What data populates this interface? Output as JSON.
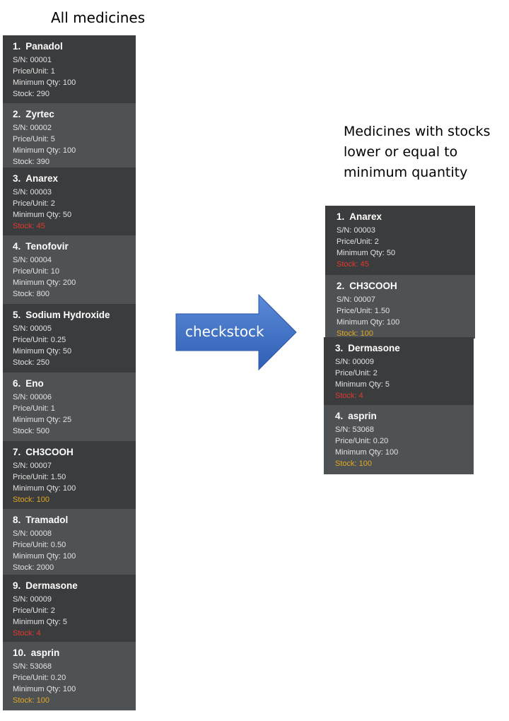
{
  "left_title": "All medicines",
  "right_title": "Medicines with stocks lower or equal to minimum quantity",
  "command": "checkstock",
  "colors": {
    "card_dark": "#3b3c3e",
    "card_light": "#4f5254",
    "stock_below_minimum": "#e03a2e",
    "stock_at_minimum": "#e2a822",
    "arrow": "#4a78c8"
  },
  "all_medicines": [
    {
      "index": "1.",
      "name": "Panadol",
      "sn": "S/N: 00001",
      "price": "Price/Unit: 1",
      "min": "Minimum Qty: 100",
      "stock": "Stock: 290",
      "stock_status": "normal"
    },
    {
      "index": "2.",
      "name": "Zyrtec",
      "sn": "S/N: 00002",
      "price": "Price/Unit: 5",
      "min": "Minimum Qty: 100",
      "stock": "Stock: 390",
      "stock_status": "normal"
    },
    {
      "index": "3.",
      "name": "Anarex",
      "sn": "S/N: 00003",
      "price": "Price/Unit: 2",
      "min": "Minimum Qty: 50",
      "stock": "Stock: 45",
      "stock_status": "low"
    },
    {
      "index": "4.",
      "name": "Tenofovir",
      "sn": "S/N: 00004",
      "price": "Price/Unit: 10",
      "min": "Minimum Qty: 200",
      "stock": "Stock: 800",
      "stock_status": "normal"
    },
    {
      "index": "5.",
      "name": "Sodium Hydroxide",
      "sn": "S/N: 00005",
      "price": "Price/Unit: 0.25",
      "min": "Minimum Qty: 50",
      "stock": "Stock: 250",
      "stock_status": "normal"
    },
    {
      "index": "6.",
      "name": "Eno",
      "sn": "S/N: 00006",
      "price": "Price/Unit: 1",
      "min": "Minimum Qty: 25",
      "stock": "Stock: 500",
      "stock_status": "normal"
    },
    {
      "index": "7.",
      "name": "CH3COOH",
      "sn": "S/N: 00007",
      "price": "Price/Unit: 1.50",
      "min": "Minimum Qty: 100",
      "stock": "Stock: 100",
      "stock_status": "equal"
    },
    {
      "index": "8.",
      "name": "Tramadol",
      "sn": "S/N: 00008",
      "price": "Price/Unit: 0.50",
      "min": "Minimum Qty: 100",
      "stock": "Stock: 2000",
      "stock_status": "normal"
    },
    {
      "index": "9.",
      "name": "Dermasone",
      "sn": "S/N: 00009",
      "price": "Price/Unit: 2",
      "min": "Minimum Qty: 5",
      "stock": "Stock: 4",
      "stock_status": "low"
    },
    {
      "index": "10.",
      "name": "asprin",
      "sn": "S/N: 53068",
      "price": "Price/Unit: 0.20",
      "min": "Minimum Qty: 100",
      "stock": "Stock: 100",
      "stock_status": "equal"
    }
  ],
  "low_stock_medicines": [
    {
      "index": "1.",
      "name": "Anarex",
      "sn": "S/N: 00003",
      "price": "Price/Unit: 2",
      "min": "Minimum Qty: 50",
      "stock": "Stock: 45",
      "stock_status": "low"
    },
    {
      "index": "2.",
      "name": "CH3COOH",
      "sn": "S/N: 00007",
      "price": "Price/Unit: 1.50",
      "min": "Minimum Qty: 100",
      "stock": "Stock: 100",
      "stock_status": "equal"
    },
    {
      "index": "3.",
      "name": "Dermasone",
      "sn": "S/N: 00009",
      "price": "Price/Unit: 2",
      "min": "Minimum Qty: 5",
      "stock": "Stock: 4",
      "stock_status": "low"
    },
    {
      "index": "4.",
      "name": "asprin",
      "sn": "S/N: 53068",
      "price": "Price/Unit: 0.20",
      "min": "Minimum Qty: 100",
      "stock": "Stock: 100",
      "stock_status": "equal"
    }
  ]
}
